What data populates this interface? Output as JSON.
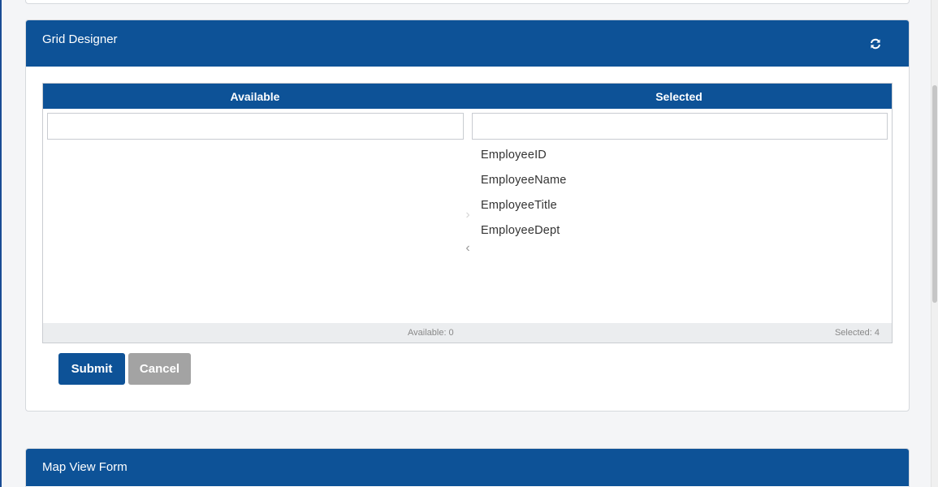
{
  "grid_designer": {
    "title": "Grid Designer",
    "refresh_icon": "refresh-icon",
    "listbox": {
      "available_header": "Available",
      "selected_header": "Selected",
      "available_filter_value": "",
      "selected_filter_value": "",
      "available_items": [],
      "selected_items": [
        "EmployeeID",
        "EmployeeName",
        "EmployeeTitle",
        "EmployeeDept"
      ],
      "move_right_icon": "chevron-right-icon",
      "move_left_icon": "chevron-left-icon",
      "available_count": "Available: 0",
      "selected_count": "Selected: 4"
    },
    "submit_label": "Submit",
    "cancel_label": "Cancel"
  },
  "map_view_form": {
    "title": "Map View Form"
  },
  "colors": {
    "header_blue": "#0d5297",
    "cancel_gray": "#a3a3a3",
    "footer_gray": "#ebedef"
  }
}
